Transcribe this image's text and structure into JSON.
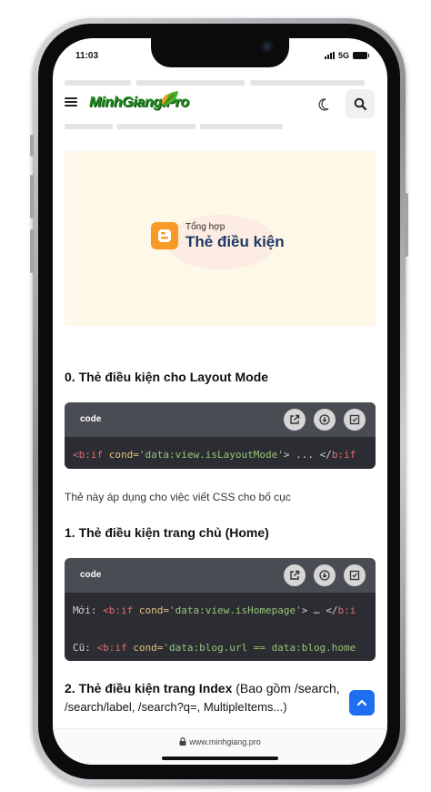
{
  "status_bar": {
    "time": "11:03",
    "network": "5G"
  },
  "header": {
    "logo": "MinhGiang.Pro"
  },
  "banner": {
    "small": "Tổng hợp",
    "big": "Thẻ điều kiện"
  },
  "sections": [
    {
      "title": "0. Thẻ điều kiện cho Layout Mode"
    },
    {
      "title": "1. Thẻ điều kiện trang chủ (Home)"
    },
    {
      "title": "2. Thẻ điều kiện trang Index",
      "title_extra": "(Bao gồm /search,",
      "line2": "/search/label, /search?q=, MultipleItems...)"
    }
  ],
  "code_blocks": [
    {
      "lang": "code",
      "lines": [
        {
          "prefix": "",
          "tag": "<b:if",
          "attr": " cond=",
          "value": "'data:view.isLayoutMode'",
          "rest": "> ... </",
          "end_tag": "b:if"
        }
      ]
    },
    {
      "lang": "code",
      "lines": [
        {
          "prefix": "Mới: ",
          "tag": "<b:if",
          "attr": " cond=",
          "value": "'data:view.isHomepage'",
          "rest": "> … </",
          "end_tag": "b:i"
        },
        {
          "prefix": "Cũ: ",
          "tag": "<b:if",
          "attr": " cond=",
          "value": "'data:blog.url == data:blog.home",
          "rest": "",
          "end_tag": ""
        }
      ]
    }
  ],
  "paragraph_1": "Thẻ này áp dụng cho việc viết CSS cho bố cục",
  "footer": {
    "url": "www.minhgiang.pro"
  },
  "colors": {
    "accent": "#1e6ff0",
    "code_bg": "#2b2d32",
    "code_head": "#4a4c53",
    "banner_bg": "#fdf8e8"
  }
}
